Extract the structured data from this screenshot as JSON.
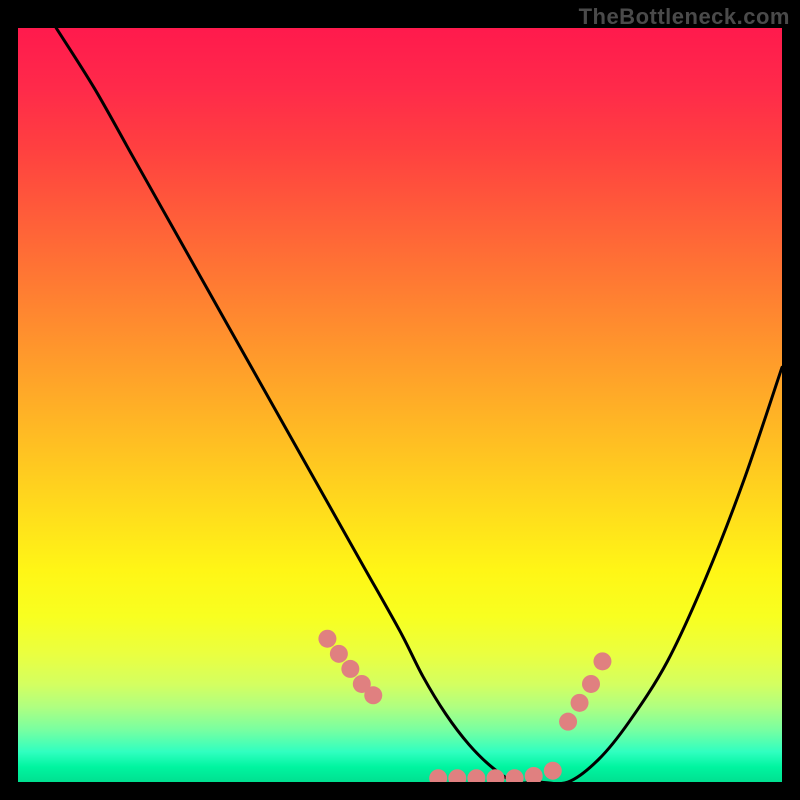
{
  "watermark": "TheBottleneck.com",
  "chart_data": {
    "type": "line",
    "title": "",
    "xlabel": "",
    "ylabel": "",
    "xlim": [
      0,
      100
    ],
    "ylim": [
      0,
      100
    ],
    "grid": false,
    "legend": false,
    "background_gradient": {
      "top": "#ff1a4d",
      "mid": "#ffe020",
      "bottom": "#00e090"
    },
    "series": [
      {
        "name": "bottleneck-curve",
        "color": "#000000",
        "x": [
          5,
          10,
          15,
          20,
          25,
          30,
          35,
          40,
          45,
          50,
          53,
          56,
          59,
          62,
          65,
          68,
          72,
          76,
          80,
          85,
          90,
          95,
          100
        ],
        "y": [
          100,
          92,
          83,
          74,
          65,
          56,
          47,
          38,
          29,
          20,
          14,
          9,
          5,
          2,
          0,
          0,
          0,
          3,
          8,
          16,
          27,
          40,
          55
        ]
      }
    ],
    "markers": {
      "name": "highlight-dots",
      "color": "#e08080",
      "radius_px": 9,
      "x": [
        40.5,
        42.0,
        43.5,
        45.0,
        46.5,
        55.0,
        57.5,
        60.0,
        62.5,
        65.0,
        67.5,
        70.0,
        72.0,
        73.5,
        75.0,
        76.5
      ],
      "y": [
        19.0,
        17.0,
        15.0,
        13.0,
        11.5,
        0.5,
        0.5,
        0.5,
        0.5,
        0.5,
        0.8,
        1.5,
        8.0,
        10.5,
        13.0,
        16.0
      ]
    }
  }
}
